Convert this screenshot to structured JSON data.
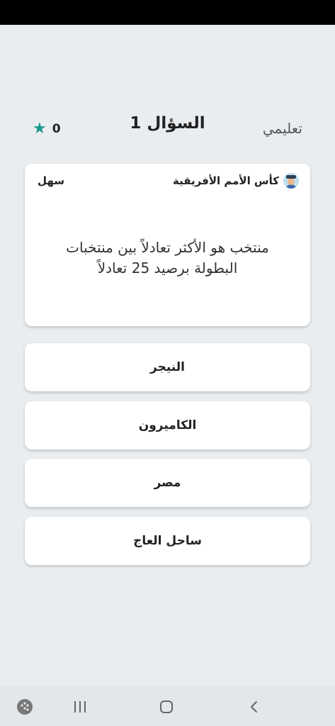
{
  "header": {
    "mode_label": "تعليمي",
    "question_title": "السؤال 1",
    "score": "0",
    "star_icon": "star-icon"
  },
  "question_card": {
    "category": "كأس الأمم الأفريقية",
    "difficulty": "سهل",
    "question": "منتخب هو الأكثر تعادلاً بين منتخبات البطولة برصيد 25 تعادلاً"
  },
  "answers": [
    {
      "label": "النيجر"
    },
    {
      "label": "الكاميرون"
    },
    {
      "label": "مصر"
    },
    {
      "label": "ساحل العاج"
    }
  ],
  "colors": {
    "background": "#eaedf0",
    "accent": "#1a9a8a",
    "card": "#ffffff"
  },
  "nav": {
    "icons": [
      "game-launcher-icon",
      "recent-apps-icon",
      "home-icon",
      "back-icon"
    ]
  }
}
